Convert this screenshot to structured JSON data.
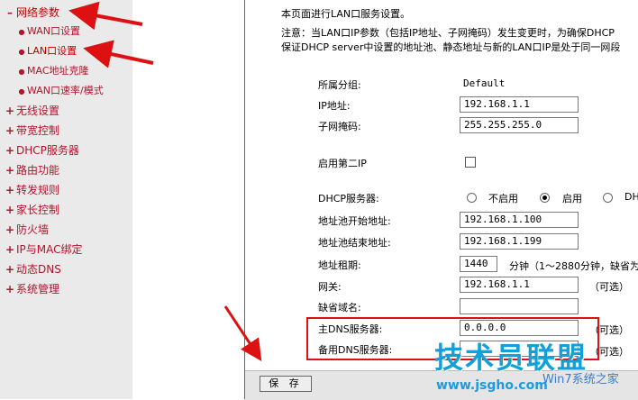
{
  "sidebar": {
    "items": [
      {
        "label": "网络参数",
        "mark": "–",
        "level": "top",
        "active": true
      },
      {
        "label": "WAN口设置",
        "level": "sub"
      },
      {
        "label": "LAN口设置",
        "level": "sub",
        "active": true
      },
      {
        "label": "MAC地址克隆",
        "level": "sub"
      },
      {
        "label": "WAN口速率/模式",
        "level": "sub"
      },
      {
        "label": "无线设置",
        "mark": "+",
        "level": "top"
      },
      {
        "label": "带宽控制",
        "mark": "+",
        "level": "top"
      },
      {
        "label": "DHCP服务器",
        "mark": "+",
        "level": "top"
      },
      {
        "label": "路由功能",
        "mark": "+",
        "level": "top"
      },
      {
        "label": "转发规则",
        "mark": "+",
        "level": "top"
      },
      {
        "label": "家长控制",
        "mark": "+",
        "level": "top"
      },
      {
        "label": "防火墙",
        "mark": "+",
        "level": "top"
      },
      {
        "label": "IP与MAC绑定",
        "mark": "+",
        "level": "top"
      },
      {
        "label": "动态DNS",
        "mark": "+",
        "level": "top"
      },
      {
        "label": "系统管理",
        "mark": "+",
        "level": "top"
      }
    ]
  },
  "intro": {
    "line1": "本页面进行LAN口服务设置。",
    "line2": "注意：当LAN口IP参数（包括IP地址、子网掩码）发生变更时，为确保DHCP",
    "line3": "保证DHCP server中设置的地址池、静态地址与新的LAN口IP是处于同一网段"
  },
  "form": {
    "group_label": "所属分组:",
    "group_value": "Default",
    "ip_label": "IP地址:",
    "ip_value": "192.168.1.1",
    "mask_label": "子网掩码:",
    "mask_value": "255.255.255.0",
    "second_ip_label": "启用第二IP",
    "dhcp_label": "DHCP服务器:",
    "dhcp_opt_disable": "不启用",
    "dhcp_opt_enable": "启用",
    "dhcp_opt_third": "DH",
    "pool_start_label": "地址池开始地址:",
    "pool_start_value": "192.168.1.100",
    "pool_end_label": "地址池结束地址:",
    "pool_end_value": "192.168.1.199",
    "lease_label": "地址租期:",
    "lease_value": "1440",
    "lease_unit": "分钟（1～2880分钟，缺省为",
    "gateway_label": "网关:",
    "gateway_value": "192.168.1.1",
    "optional": "（可选）",
    "domain_label": "缺省域名:",
    "domain_value": "",
    "dns1_label": "主DNS服务器:",
    "dns1_value": "0.0.0.0",
    "dns2_label": "备用DNS服务器:",
    "dns2_value": ""
  },
  "footer": {
    "save_label": "保 存"
  },
  "watermark": {
    "big": "技术员联盟",
    "url": "www.jsgho.com",
    "right": "Win7系统之家"
  },
  "colors": {
    "annotation_red": "#dd1111",
    "menu_red": "#b3132b",
    "sidebar_bg": "#eaeaea"
  }
}
